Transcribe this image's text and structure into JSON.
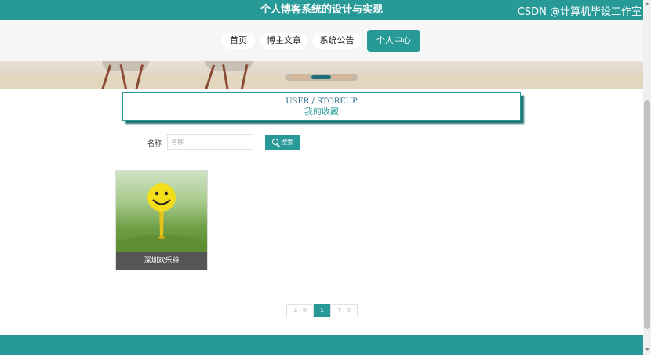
{
  "header": {
    "title": "个人博客系统的设计与实现"
  },
  "nav": {
    "items": [
      {
        "label": "首页"
      },
      {
        "label": "博主文章"
      },
      {
        "label": "系统公告"
      },
      {
        "label": "个人中心"
      }
    ],
    "active_index": 3
  },
  "section": {
    "en": "USER / STOREUP",
    "cn": "我的收藏"
  },
  "search": {
    "label": "名称",
    "placeholder": "名称",
    "value": "",
    "button": "搜索"
  },
  "cards": [
    {
      "caption": "深圳欢乐谷",
      "image_icon": "smiley-golf-ball-image"
    }
  ],
  "pagination": {
    "prev": "上一页",
    "current": "1",
    "next": "下一页"
  },
  "footer": {
    "watermark": "CSDN @计算机毕设工作室"
  },
  "colors": {
    "primary": "#279a98",
    "caption_bg": "#555555"
  }
}
